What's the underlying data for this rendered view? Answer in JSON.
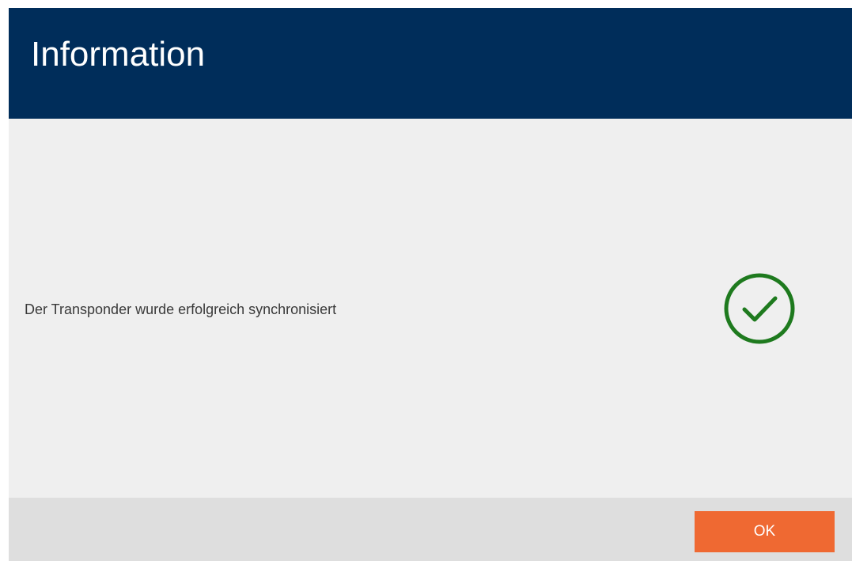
{
  "dialog": {
    "title": "Information",
    "message": "Der Transponder wurde erfolgreich synchronisiert",
    "status_icon": "checkmark-circle-icon",
    "ok_label": "OK"
  },
  "colors": {
    "title_bar": "#002d5a",
    "content_background": "#efefef",
    "footer_background": "#dedede",
    "success": "#1e7a1e",
    "ok_button": "#ef6932"
  }
}
